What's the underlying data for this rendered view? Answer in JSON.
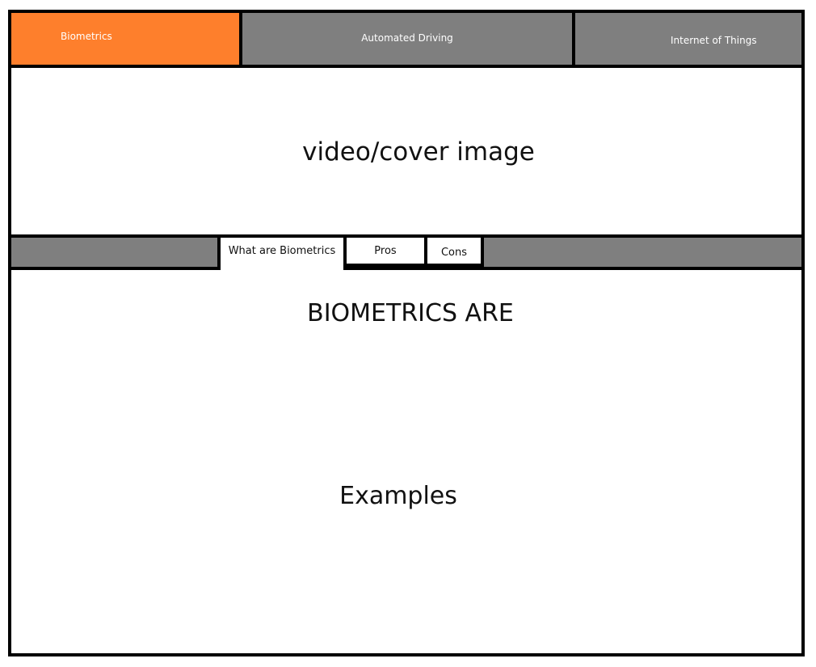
{
  "top_nav": {
    "tabs": [
      {
        "label": "Biometrics",
        "active": true,
        "color": "#fe7f2c"
      },
      {
        "label": "Automated Driving",
        "active": false,
        "color": "#7f7f7f"
      },
      {
        "label": "Internet of Things",
        "active": false,
        "color": "#7f7f7f"
      }
    ]
  },
  "cover": {
    "label": "video/cover image"
  },
  "sub_nav": {
    "tabs": [
      {
        "label": "What are Biometrics",
        "active": true
      },
      {
        "label": "Pros",
        "active": false
      },
      {
        "label": "Cons",
        "active": false
      }
    ]
  },
  "content": {
    "heading": "BIOMETRICS ARE",
    "examples": "Examples"
  }
}
